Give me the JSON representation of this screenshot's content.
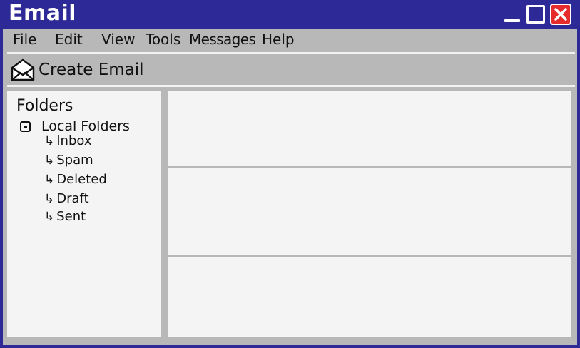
{
  "window": {
    "title": "Email",
    "controls": {
      "minimize_icon": "minimize-icon",
      "maximize_icon": "maximize-icon",
      "close_icon": "close-icon"
    },
    "colors": {
      "titlebar": "#2d2a97",
      "close_button": "#e52b2b",
      "chrome": "#b8b8b8",
      "panel": "#f4f4f4"
    }
  },
  "menu": {
    "items": [
      "File",
      "Edit",
      "View",
      "Tools",
      "Messages",
      "Help"
    ]
  },
  "toolbar": {
    "create_label": "Create Email",
    "create_icon": "envelope-open-icon"
  },
  "folders": {
    "heading": "Folders",
    "root": {
      "label": "Local Folders",
      "expanded": true,
      "children": [
        "Inbox",
        "Spam",
        "Deleted",
        "Draft",
        "Sent"
      ]
    },
    "child_arrow": "↳"
  },
  "content": {
    "panels": [
      "",
      "",
      ""
    ]
  }
}
